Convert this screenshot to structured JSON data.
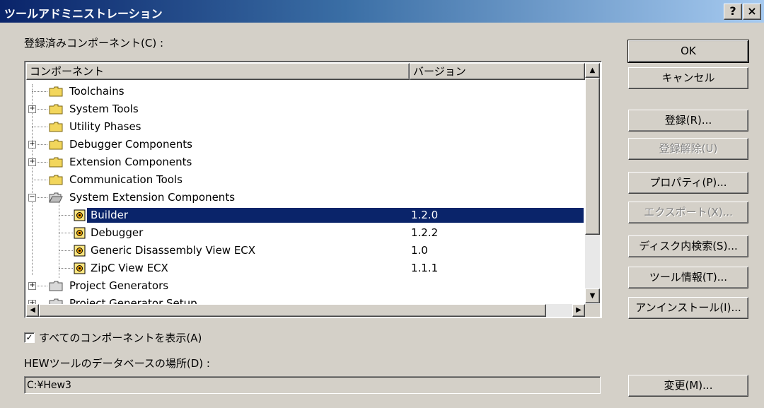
{
  "window": {
    "title": "ツールアドミニストレーション",
    "help_label": "?",
    "close_label": "×"
  },
  "components_label": "登録済みコンポーネント(C) :",
  "list": {
    "col_component": "コンポーネント",
    "col_version": "バージョン",
    "rows": [
      {
        "name": "Toolchains",
        "version": ""
      },
      {
        "name": "System Tools",
        "version": ""
      },
      {
        "name": "Utility Phases",
        "version": ""
      },
      {
        "name": "Debugger Components",
        "version": ""
      },
      {
        "name": "Extension Components",
        "version": ""
      },
      {
        "name": "Communication Tools",
        "version": ""
      },
      {
        "name": "System Extension Components",
        "version": ""
      },
      {
        "name": "Builder",
        "version": "1.2.0"
      },
      {
        "name": "Debugger",
        "version": "1.2.2"
      },
      {
        "name": "Generic Disassembly View ECX",
        "version": "1.0"
      },
      {
        "name": "ZipC View ECX",
        "version": "1.1.1"
      },
      {
        "name": "Project Generators",
        "version": ""
      },
      {
        "name": "Project Generator Setup",
        "version": ""
      }
    ]
  },
  "show_all": {
    "label": "すべてのコンポーネントを表示(A)",
    "checked": true
  },
  "db_location": {
    "label": "HEWツールのデータベースの場所(D) :",
    "value": "C:¥Hew3"
  },
  "buttons": {
    "ok": "OK",
    "cancel": "キャンセル",
    "register": "登録(R)...",
    "unregister": "登録解除(U)",
    "properties": "プロパティ(P)...",
    "export": "エクスポート(X)...",
    "disk_search": "ディスク内検索(S)...",
    "tool_info": "ツール情報(T)...",
    "uninstall": "アンインストール(I)...",
    "change": "変更(M)..."
  },
  "colors": {
    "title_bg": "#0a246a",
    "selection": "#0a246a",
    "dialog_bg": "#d4d0c8"
  }
}
